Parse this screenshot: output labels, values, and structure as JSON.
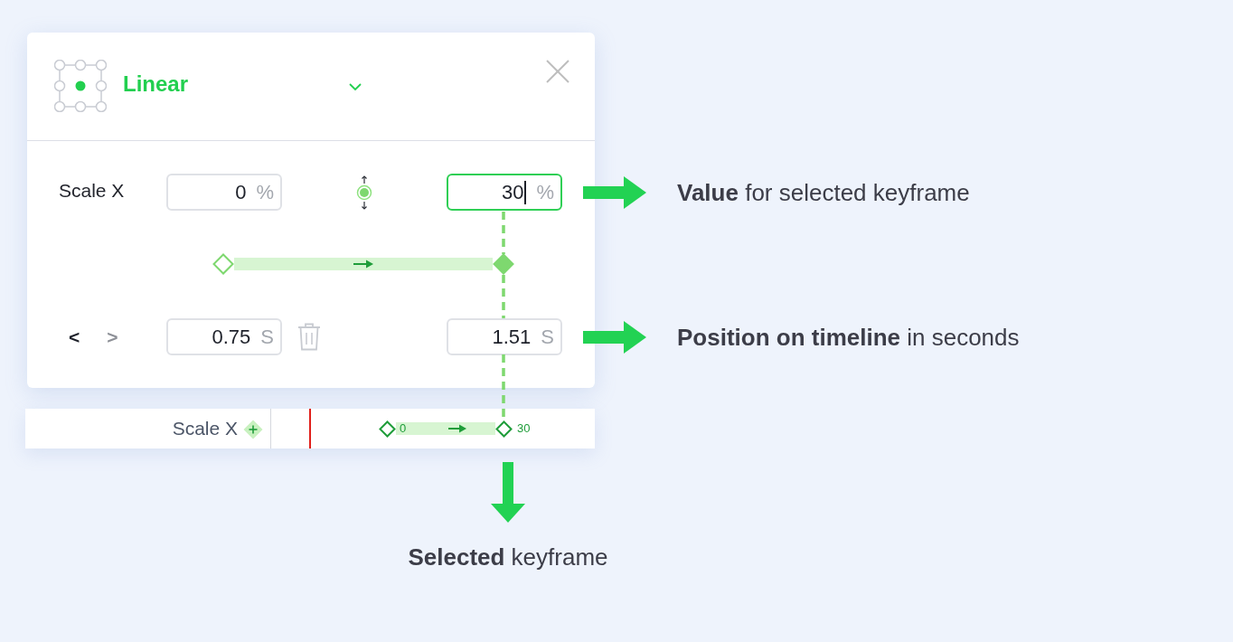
{
  "editor": {
    "easing": "Linear",
    "property": "Scale X",
    "nav": [
      {
        "label": "<",
        "disabled": false
      },
      {
        "label": ">",
        "disabled": true
      }
    ],
    "keyframes": [
      {
        "value": {
          "text": "0",
          "unit": "%",
          "focused": false
        },
        "time": {
          "text": "0.75",
          "unit": "S"
        },
        "selected": false
      },
      {
        "value": {
          "text": "30",
          "unit": "%",
          "focused": true
        },
        "time": {
          "text": "1.51",
          "unit": "S"
        },
        "selected": true
      }
    ]
  },
  "timeline": {
    "label": "Scale X",
    "keyframes": [
      {
        "label": "0"
      },
      {
        "label": "30"
      }
    ]
  },
  "annotations": [
    {
      "text": "**Value** for selected keyframe"
    },
    {
      "text": "**Position on timeline** in seconds"
    }
  ],
  "caption": {
    "text": "**Selected** keyframe"
  }
}
